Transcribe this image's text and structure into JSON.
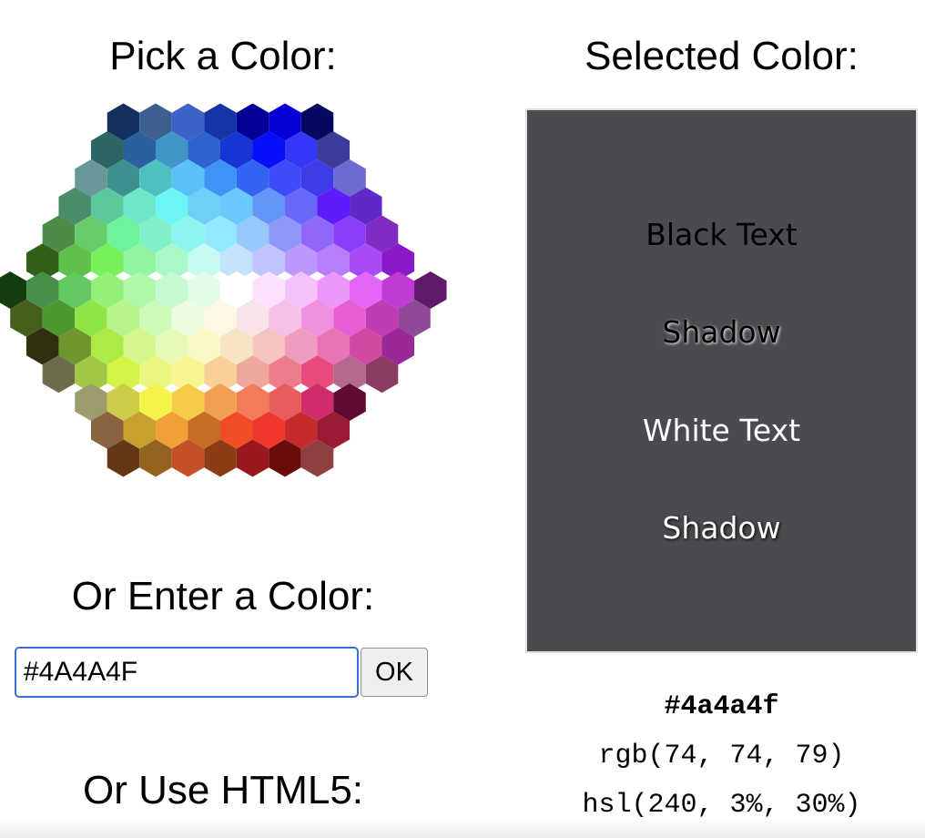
{
  "picker": {
    "title": "Pick a Color:",
    "hex_rows": [
      [
        "#14305e",
        "#3c6090",
        "#3c63c8",
        "#1535a6",
        "#040096",
        "#0400d7",
        "#050860"
      ],
      [
        "#2d6464",
        "#2b609e",
        "#4196c8",
        "#2e64cc",
        "#1834d6",
        "#0610f8",
        "#3636f8",
        "#3c3c9a"
      ],
      [
        "#6a9898",
        "#3b9090",
        "#4fc0c0",
        "#59c1f8",
        "#3e94f4",
        "#3264f4",
        "#3c4cfa",
        "#3d3ce8",
        "#6a6ad0"
      ],
      [
        "#4c8c6a",
        "#5cc89c",
        "#6ee6ca",
        "#6cf6f6",
        "#6cd0f8",
        "#6ac8fc",
        "#6496fa",
        "#6868f8",
        "#5e1cf8",
        "#5f28c8"
      ],
      [
        "#4c8c46",
        "#66cc6c",
        "#6ef29a",
        "#80f0c8",
        "#8cf6ee",
        "#92e8fc",
        "#96c8fa",
        "#8f96fa",
        "#8f68fa",
        "#8a3efa",
        "#802cc2"
      ],
      [
        "#316019",
        "#60c04c",
        "#78f05a",
        "#92f4a0",
        "#aaf8c8",
        "#c8faf4",
        "#c4e2fc",
        "#c0c4fc",
        "#bc98fc",
        "#b87cfc",
        "#a84af6",
        "#8a1ac8"
      ],
      [
        "#143c10",
        "#48904a",
        "#62c862",
        "#94f078",
        "#aef8a8",
        "#c6fad0",
        "#e2fce8",
        "#ffffff",
        "#fce2fc",
        "#f6c2fc",
        "#ec96fc",
        "#e466f8",
        "#c03ad4",
        "#601a6a"
      ],
      [
        "#45601c",
        "#4c982c",
        "#90e448",
        "#b8f48c",
        "#ccfab8",
        "#ecfce0",
        "#fcf8e4",
        "#f8e4e8",
        "#f6c0e8",
        "#f090e0",
        "#e85ed4",
        "#c03cb4",
        "#904898"
      ],
      [
        "#303010",
        "#6e962c",
        "#acea44",
        "#d4f68c",
        "#e6fab8",
        "#faf8c4",
        "#f6e4c4",
        "#f6c4c0",
        "#f09cc0",
        "#e874b4",
        "#d04aa4",
        "#9c2898"
      ],
      [
        "#6c6c4c",
        "#a0c844",
        "#d4f448",
        "#eaf680",
        "#f8f494",
        "#f8d098",
        "#f0a89c",
        "#ec7c8c",
        "#e84c7c",
        "#b46890",
        "#8a3c64"
      ],
      [
        "#9c9c6c",
        "#cccc48",
        "#f4f448",
        "#f4cc48",
        "#f0a050",
        "#f07c58",
        "#e85c5c",
        "#d02c6c",
        "#600a34"
      ],
      [
        "#8a6440",
        "#c8a030",
        "#f0a038",
        "#c86c28",
        "#f04c28",
        "#f0382c",
        "#c42c2c",
        "#9a1c34"
      ],
      [
        "#643814",
        "#926420",
        "#c45028",
        "#8c3c14",
        "#98181c",
        "#6a0c0c",
        "#904040"
      ]
    ]
  },
  "entry": {
    "title": "Or Enter a Color:",
    "input_value": "#4A4A4F",
    "ok_label": "OK"
  },
  "html5": {
    "title": "Or Use HTML5:"
  },
  "selected": {
    "title": "Selected Color:",
    "color": "#4a4a4f",
    "samples": {
      "black_text": "Black Text",
      "black_shadow": "Shadow",
      "white_text": "White Text",
      "white_shadow": "Shadow"
    },
    "hex": "#4a4a4f",
    "rgb": "rgb(74, 74, 79)",
    "hsl": "hsl(240, 3%, 30%)"
  }
}
